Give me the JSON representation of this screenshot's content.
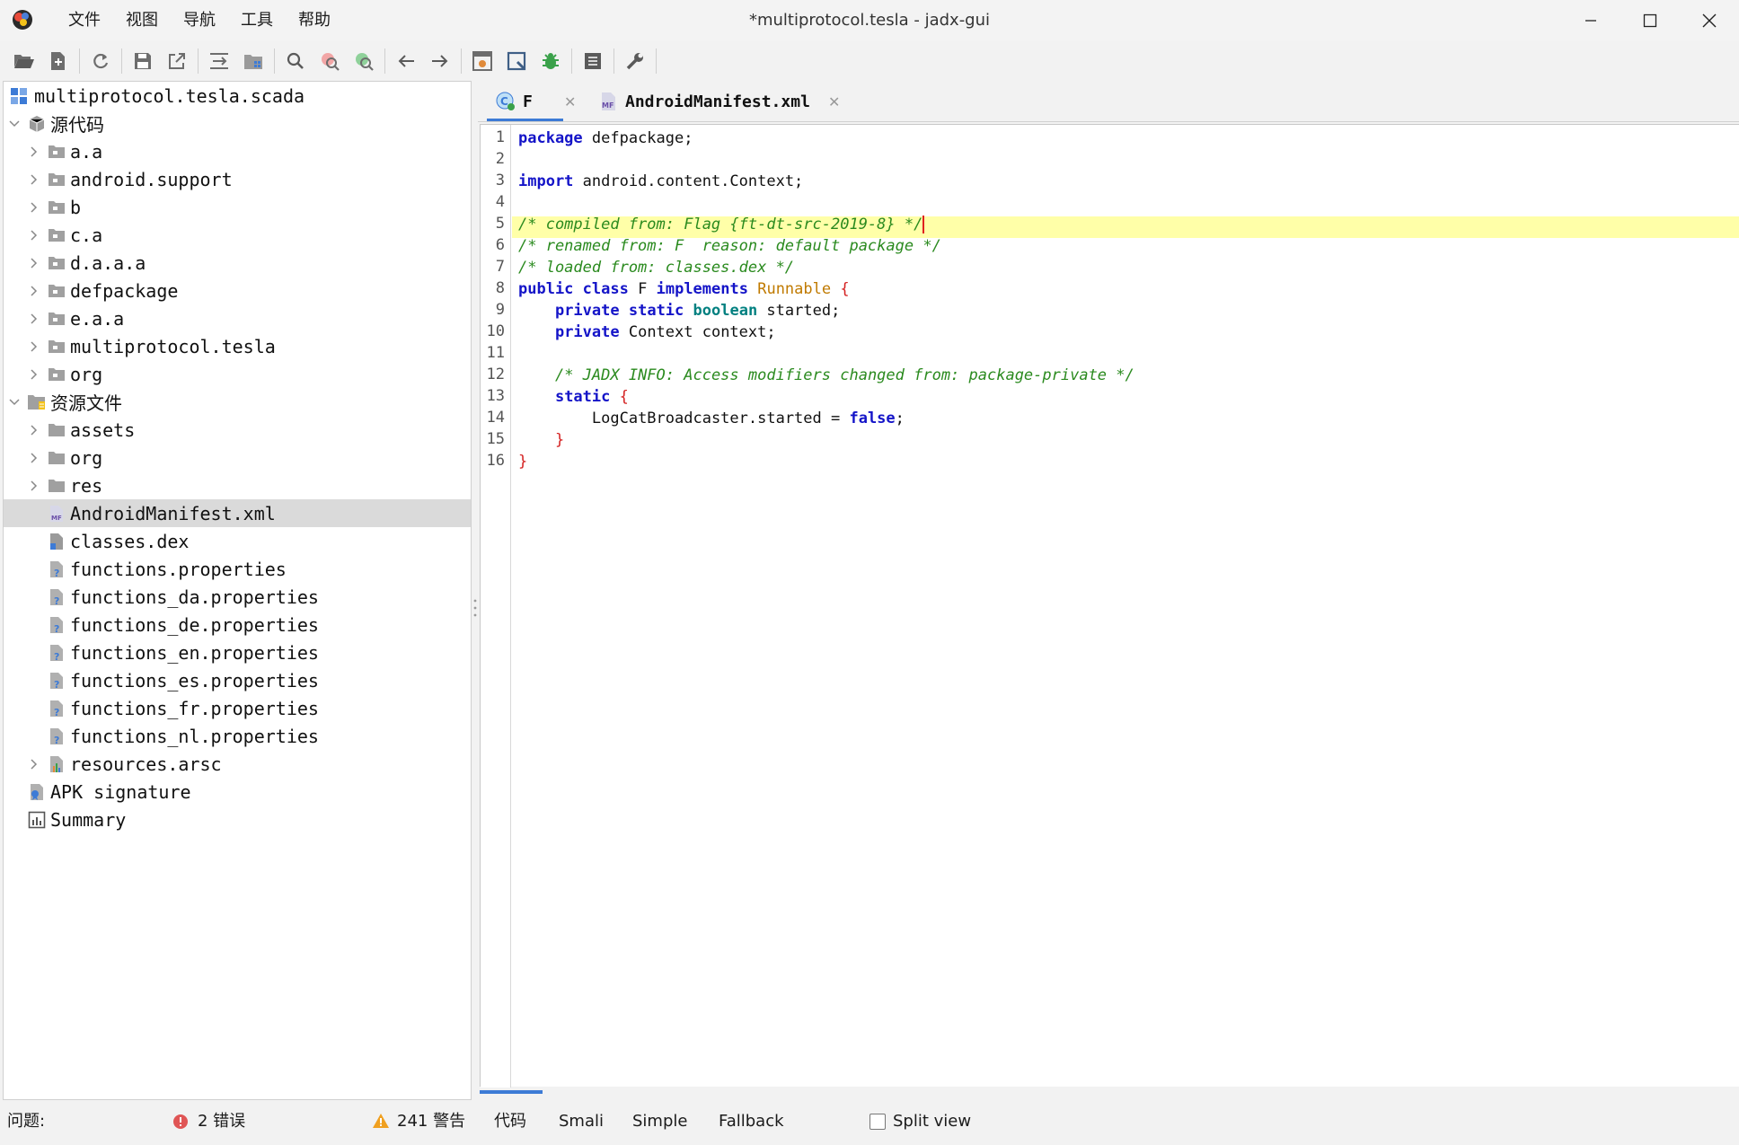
{
  "window": {
    "title": "*multiprotocol.tesla - jadx-gui",
    "menu": [
      "文件",
      "视图",
      "导航",
      "工具",
      "帮助"
    ]
  },
  "toolbar": {
    "icons": [
      "open-file-icon",
      "add-files-icon",
      "reload-icon",
      "save-all-icon",
      "export-icon",
      "sync-editor-icon",
      "flatten-packages-icon",
      "search-text-icon",
      "search-class-icon",
      "find-usage-icon",
      "back-icon",
      "forward-icon",
      "deobfuscation-icon",
      "quark-icon",
      "debugger-icon",
      "log-viewer-icon",
      "preferences-icon"
    ]
  },
  "tree": {
    "root": "multiprotocol.tesla.scada",
    "source_group": "源代码",
    "packages": [
      "a.a",
      "android.support",
      "b",
      "c.a",
      "d.a.a.a",
      "defpackage",
      "e.a.a",
      "multiprotocol.tesla",
      "org"
    ],
    "resources_group": "资源文件",
    "resource_folders": [
      "assets",
      "org",
      "res"
    ],
    "resource_files": [
      "AndroidManifest.xml",
      "classes.dex",
      "functions.properties",
      "functions_da.properties",
      "functions_de.properties",
      "functions_en.properties",
      "functions_es.properties",
      "functions_fr.properties",
      "functions_nl.properties"
    ],
    "resources_arsc": "resources.arsc",
    "apk_signature": "APK signature",
    "summary": "Summary",
    "selected": "AndroidManifest.xml"
  },
  "tabs": [
    {
      "label": "F",
      "icon": "class-icon",
      "active": true
    },
    {
      "label": "AndroidManifest.xml",
      "icon": "manifest-icon",
      "active": false
    }
  ],
  "code": {
    "line_numbers": [
      "1",
      "2",
      "3",
      "4",
      "5",
      "6",
      "7",
      "8",
      "9",
      "10",
      "11",
      "12",
      "13",
      "14",
      "15",
      "16"
    ],
    "l1_kw": "package",
    "l1_rest": " defpackage;",
    "l3_kw": "import",
    "l3_rest": " android.content.Context;",
    "l5_cm": "/* compiled from: Flag {ft-dt-src-2019-8} */",
    "l6_cm": "/* renamed from: F  reason: default package */",
    "l7_cm": "/* loaded from: classes.dex */",
    "l8_public": "public",
    "l8_class": "class",
    "l8_name": "F",
    "l8_implements": "implements",
    "l8_type": "Runnable",
    "l8_brace": "{",
    "l9_private": "private",
    "l9_static": "static",
    "l9_boolean": "boolean",
    "l9_rest": " started;",
    "l10_private": "private",
    "l10_rest": " Context context;",
    "l12_cm": "/* JADX INFO: Access modifiers changed from: package-private */",
    "l13_static": "static",
    "l13_brace": "{",
    "l14_pre": "LogCatBroadcaster.started = ",
    "l14_false": "false",
    "l14_semi": ";",
    "l15_brace": "}",
    "l16_brace": "}",
    "current_line": 5
  },
  "view_tabs": [
    "代码",
    "Smali",
    "Simple",
    "Fallback"
  ],
  "split_view": {
    "label": "Split view",
    "checked": false
  },
  "status": {
    "problems_label": "问题:",
    "errors": "2 错误",
    "warnings": "241 警告"
  },
  "colors": {
    "keyword": "#1414c8",
    "comment": "#2a8a1e",
    "type": "#c07a00",
    "brace": "#d42020",
    "highlight": "#ffffa8",
    "selection": "#dadada",
    "accent": "#3d7bd6"
  }
}
